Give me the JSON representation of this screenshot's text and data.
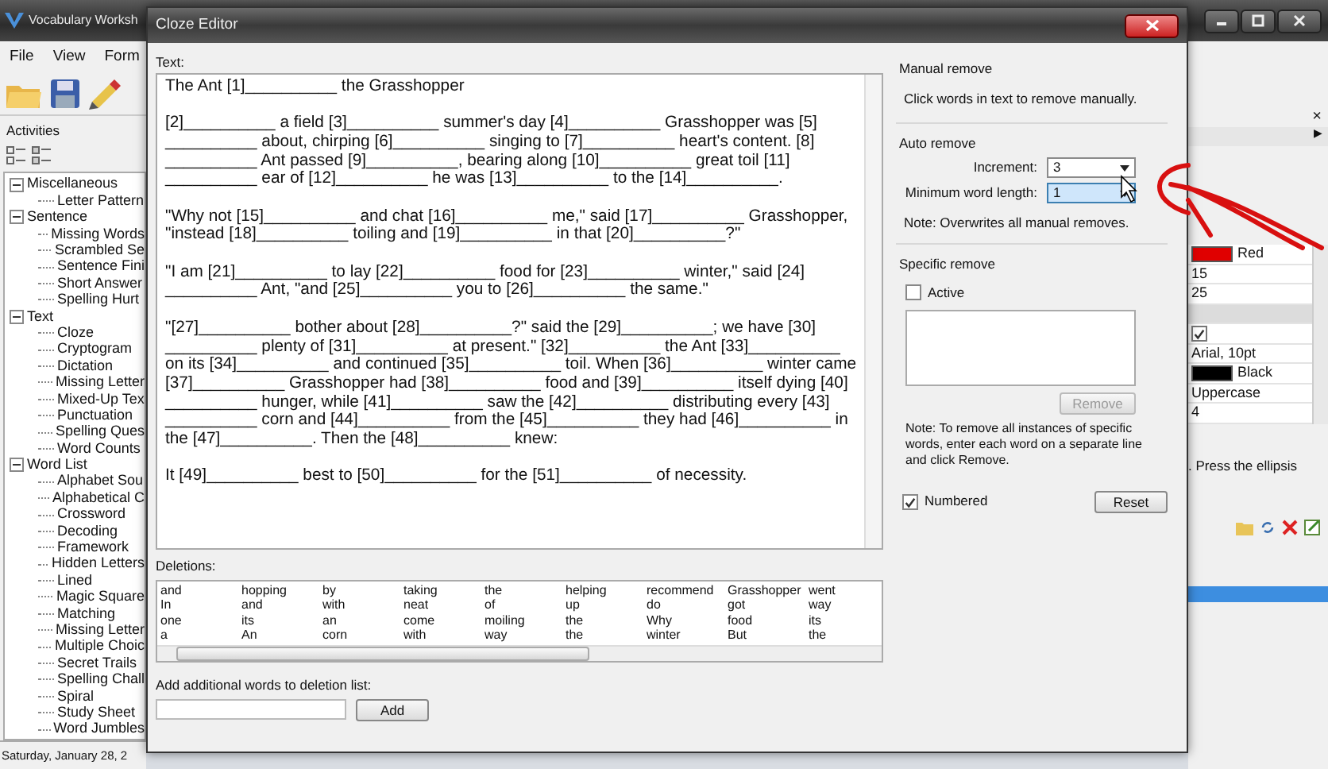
{
  "app": {
    "title": "Vocabulary Worksh",
    "menu": [
      "File",
      "View",
      "Form"
    ],
    "activities_label": "Activities",
    "tree": [
      {
        "label": "Miscellaneous",
        "expanded": true,
        "children": [
          {
            "label": "Letter Pattern"
          }
        ]
      },
      {
        "label": "Sentence",
        "expanded": true,
        "children": [
          {
            "label": "Missing Words"
          },
          {
            "label": "Scrambled Se"
          },
          {
            "label": "Sentence Fini"
          },
          {
            "label": "Short Answer"
          },
          {
            "label": "Spelling Hurt"
          }
        ]
      },
      {
        "label": "Text",
        "expanded": true,
        "children": [
          {
            "label": "Cloze"
          },
          {
            "label": "Cryptogram"
          },
          {
            "label": "Dictation"
          },
          {
            "label": "Missing Letter"
          },
          {
            "label": "Mixed-Up Tex"
          },
          {
            "label": "Punctuation"
          },
          {
            "label": "Spelling Ques"
          },
          {
            "label": "Word Counts"
          }
        ]
      },
      {
        "label": "Word List",
        "expanded": true,
        "children": [
          {
            "label": "Alphabet Sou"
          },
          {
            "label": "Alphabetical C"
          },
          {
            "label": "Crossword"
          },
          {
            "label": "Decoding"
          },
          {
            "label": "Framework"
          },
          {
            "label": "Hidden Letters"
          },
          {
            "label": "Lined"
          },
          {
            "label": "Magic Square"
          },
          {
            "label": "Matching"
          },
          {
            "label": "Missing Letter"
          },
          {
            "label": "Multiple Choic"
          },
          {
            "label": "Secret Trails"
          },
          {
            "label": "Spelling Chall"
          },
          {
            "label": "Spiral"
          },
          {
            "label": "Study Sheet"
          },
          {
            "label": "Word Jumbles"
          }
        ]
      }
    ],
    "status_bar": "Saturday, January 28, 2"
  },
  "properties": {
    "close_glyph": "×",
    "arrow_glyph": "▶",
    "rows": [
      {
        "kind": "color",
        "value": "Red",
        "color": "#e00000"
      },
      {
        "kind": "text",
        "value": "15"
      },
      {
        "kind": "text",
        "value": "25"
      },
      {
        "kind": "category"
      },
      {
        "kind": "check",
        "checked": true
      },
      {
        "kind": "text",
        "value": "Arial, 10pt"
      },
      {
        "kind": "color",
        "value": "Black",
        "color": "#000000"
      },
      {
        "kind": "text",
        "value": "Uppercase"
      },
      {
        "kind": "text",
        "value": "4"
      }
    ],
    "description": ". Press the ellipsis"
  },
  "dialog": {
    "title": "Cloze Editor",
    "text_label": "Text:",
    "paragraphs": [
      [
        "The Ant [1]__________ the Grasshopper"
      ],
      [
        "[2]__________ a field [3]__________ summer's day [4]__________ Grasshopper was [5]",
        "__________ about, chirping [6]__________ singing to [7]__________ heart's content. [8]",
        "__________ Ant passed [9]__________, bearing along [10]__________ great toil [11]",
        "__________ ear of [12]__________ he was [13]__________ to the [14]__________."
      ],
      [
        "\"Why not [15]__________ and chat [16]__________ me,\" said [17]__________ Grasshopper,",
        "\"instead [18]__________ toiling and [19]__________ in that [20]__________?\""
      ],
      [
        "\"I am [21]__________ to lay [22]__________ food for [23]__________ winter,\" said [24]",
        "__________ Ant, \"and [25]__________ you to [26]__________ the same.\""
      ],
      [
        "\"[27]__________ bother about [28]__________?\" said the [29]__________; we have [30]",
        "__________ plenty of [31]__________ at present.\" [32]__________ the Ant [33]__________",
        "on its [34]__________ and continued [35]__________ toil. When [36]__________ winter came",
        "[37]__________ Grasshopper had [38]__________ food and [39]__________ itself dying [40]",
        "__________ hunger, while [41]__________ saw the [42]__________ distributing every [43]",
        "__________ corn and [44]__________ from the [45]__________ they had [46]__________ in",
        "the [47]__________. Then the [48]__________ knew:"
      ],
      [
        "It [49]__________ best to [50]__________ for the [51]__________ of necessity."
      ]
    ],
    "deletions_label": "Deletions:",
    "deletions": [
      [
        "and",
        "hopping",
        "by",
        "taking",
        "the",
        "helping",
        "recommend",
        "Grasshopper",
        "went"
      ],
      [
        "In",
        "and",
        "with",
        "neat",
        "of",
        "up",
        "do",
        "got",
        "way"
      ],
      [
        "one",
        "its",
        "an",
        "come",
        "moiling",
        "the",
        "Why",
        "food",
        "its"
      ],
      [
        "a",
        "An",
        "corn",
        "with",
        "way",
        "the",
        "winter",
        "But",
        "the"
      ]
    ],
    "add_label": "Add additional words to deletion list:",
    "add_button": "Add",
    "manual_remove": {
      "title": "Manual remove",
      "hint": "Click words in text to remove manually."
    },
    "auto_remove": {
      "title": "Auto remove",
      "fields": [
        {
          "label": "Increment:",
          "value": "3",
          "focused": false
        },
        {
          "label": "Minimum word length:",
          "value": "1",
          "focused": true
        }
      ],
      "note": "Note: Overwrites all manual removes."
    },
    "specific_remove": {
      "title": "Specific remove",
      "active_label": "Active",
      "active": false,
      "remove_button": "Remove",
      "remove_disabled": true,
      "note": "Note: To remove all instances of specific words, enter each word on a separate line and click Remove."
    },
    "numbered_label": "Numbered",
    "numbered": true,
    "reset_button": "Reset"
  }
}
